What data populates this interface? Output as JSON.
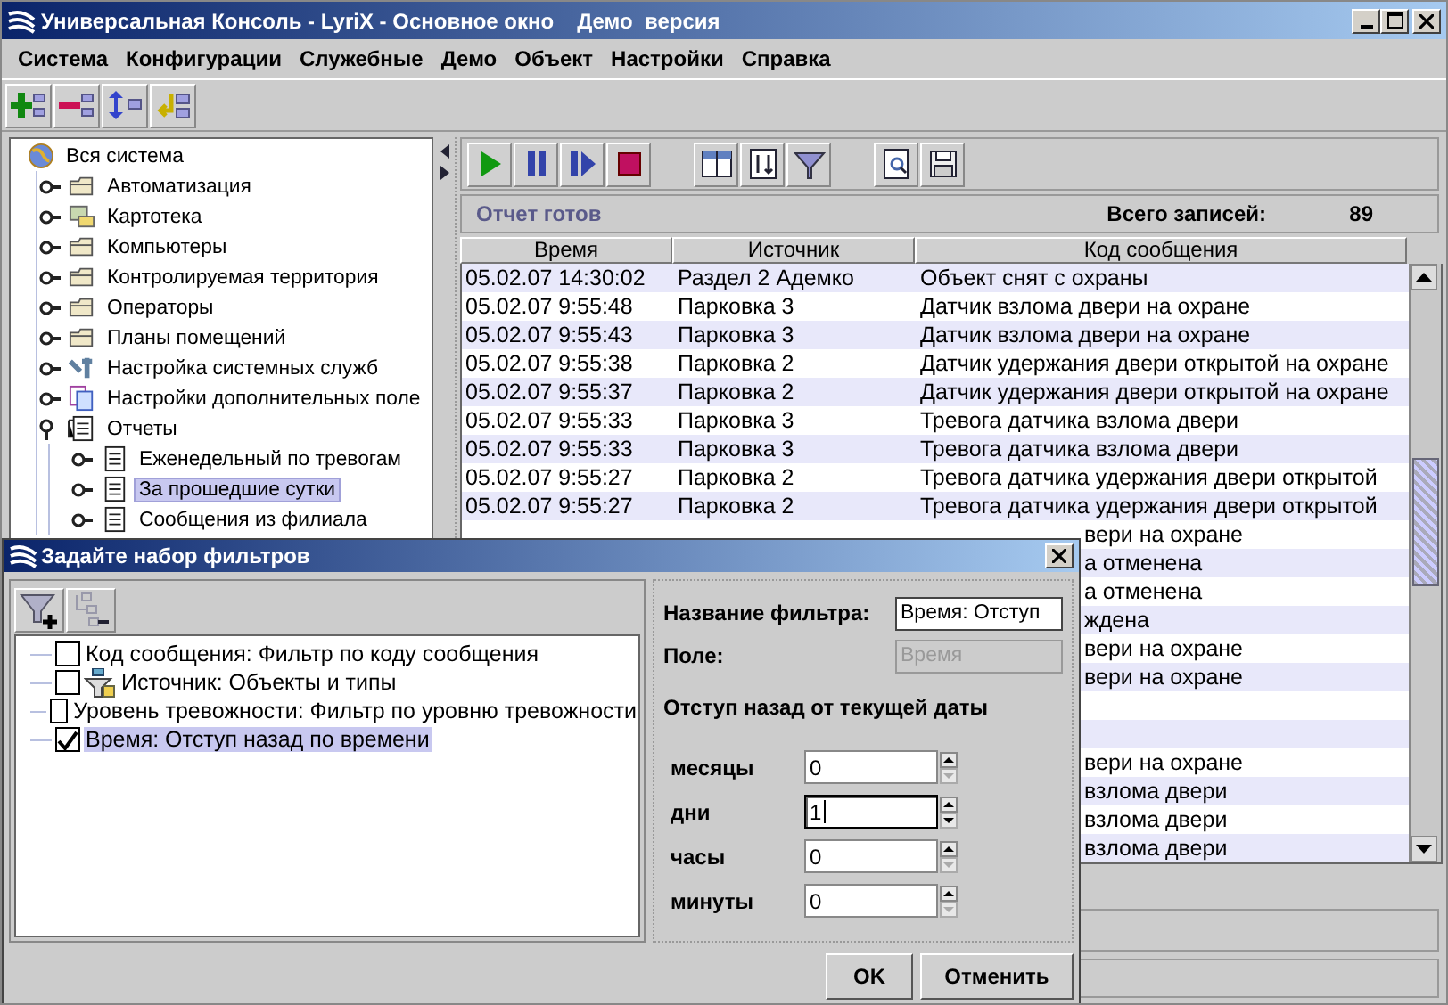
{
  "window": {
    "title": "Универсальная Консоль - LyriX - Основное окно",
    "edition": "Демо  версия"
  },
  "menu": [
    "Система",
    "Конфигурации",
    "Служебные",
    "Демо",
    "Объект",
    "Настройки",
    "Справка"
  ],
  "tree": {
    "label": "Вся система",
    "kind": "globe",
    "selected": false,
    "children": [
      {
        "label": "Автоматизация",
        "kind": "folder",
        "selected": false,
        "expanded": false
      },
      {
        "label": "Картотека",
        "kind": "cards",
        "selected": false,
        "expanded": false
      },
      {
        "label": "Компьютеры",
        "kind": "folder",
        "selected": false,
        "expanded": false
      },
      {
        "label": "Контролируемая территория",
        "kind": "folder",
        "selected": false,
        "expanded": false
      },
      {
        "label": "Операторы",
        "kind": "folder",
        "selected": false,
        "expanded": false
      },
      {
        "label": "Планы помещений",
        "kind": "folder",
        "selected": false,
        "expanded": false
      },
      {
        "label": "Настройка системных служб",
        "kind": "tools",
        "selected": false,
        "expanded": false
      },
      {
        "label": "Настройки дополнительных поле",
        "kind": "pages",
        "selected": false,
        "expanded": false
      },
      {
        "label": "Отчеты",
        "kind": "report",
        "selected": false,
        "expanded": true,
        "children": [
          {
            "label": "Еженедельный по тревогам",
            "kind": "document",
            "selected": false,
            "expanded": false
          },
          {
            "label": "За прошедшие сутки",
            "kind": "document",
            "selected": true,
            "expanded": false
          },
          {
            "label": "Сообщения из филиала",
            "kind": "document",
            "selected": false,
            "expanded": false
          }
        ]
      }
    ]
  },
  "report": {
    "status": "Отчет готов",
    "total_label": "Всего записей:",
    "total": "89"
  },
  "table": {
    "columns": [
      "Время",
      "Источник",
      "Код сообщения"
    ],
    "rows": [
      {
        "time": "05.02.07 14:30:02",
        "source": "Раздел 2 Адемко",
        "code": "Объект снят с охраны"
      },
      {
        "time": "05.02.07 9:55:48",
        "source": "Парковка 3",
        "code": "Датчик взлома двери на охране"
      },
      {
        "time": "05.02.07 9:55:43",
        "source": "Парковка 3",
        "code": "Датчик взлома двери на охране"
      },
      {
        "time": "05.02.07 9:55:38",
        "source": "Парковка 2",
        "code": "Датчик удержания двери открытой на охране"
      },
      {
        "time": "05.02.07 9:55:37",
        "source": "Парковка 2",
        "code": "Датчик удержания двери открытой на охране"
      },
      {
        "time": "05.02.07 9:55:33",
        "source": "Парковка 3",
        "code": "Тревога датчика взлома двери"
      },
      {
        "time": "05.02.07 9:55:33",
        "source": "Парковка 3",
        "code": "Тревога датчика взлома двери"
      },
      {
        "time": "05.02.07 9:55:27",
        "source": "Парковка 2",
        "code": "Тревога датчика удержания двери открытой"
      },
      {
        "time": "05.02.07 9:55:27",
        "source": "Парковка 2",
        "code": "Тревога датчика удержания двери открытой"
      }
    ],
    "rows_under_dialog": [
      {
        "kind": "fragment",
        "code": "вери на охране"
      },
      {
        "kind": "fragment",
        "code": "а отменена"
      },
      {
        "kind": "fragment",
        "code": "а отменена"
      },
      {
        "kind": "fragment",
        "code": "ждена"
      },
      {
        "kind": "fragment",
        "code": "вери на охране"
      },
      {
        "kind": "fragment",
        "code": "вери на охране"
      },
      {
        "kind": "blank"
      },
      {
        "kind": "blank"
      },
      {
        "kind": "fragment",
        "code": "вери на охране"
      },
      {
        "kind": "fragment",
        "code": "взлома двери"
      },
      {
        "kind": "fragment",
        "code": "взлома двери"
      },
      {
        "kind": "fragment",
        "code": "взлома двери"
      }
    ]
  },
  "dialog": {
    "title": "Задайте набор фильтров",
    "filters": [
      {
        "label": "Код сообщения: Фильтр по коду сообщения",
        "kind": "plain",
        "checked": false,
        "selected": false
      },
      {
        "label": "Источник: Объекты и типы",
        "kind": "object",
        "checked": false,
        "selected": false
      },
      {
        "label": "Уровень тревожности: Фильтр по уровню тревожности",
        "kind": "plain",
        "checked": false,
        "selected": false
      },
      {
        "label": "Время: Отступ назад по времени",
        "kind": "plain",
        "checked": true,
        "selected": true
      }
    ],
    "name_label": "Название фильтра:",
    "name_value": "Время: Отступ",
    "field_label": "Поле:",
    "field_value": "Время",
    "field_disabled": true,
    "section": "Отступ назад от текущей даты",
    "spinners": [
      {
        "label": "месяцы",
        "value": "0",
        "focused": false,
        "can_decrease": false
      },
      {
        "label": "дни",
        "value": "1",
        "focused": true,
        "can_decrease": true
      },
      {
        "label": "часы",
        "value": "0",
        "focused": false,
        "can_decrease": false
      },
      {
        "label": "минуты",
        "value": "0",
        "focused": false,
        "can_decrease": false
      }
    ],
    "buttons": [
      "OK",
      "Отменить"
    ]
  }
}
